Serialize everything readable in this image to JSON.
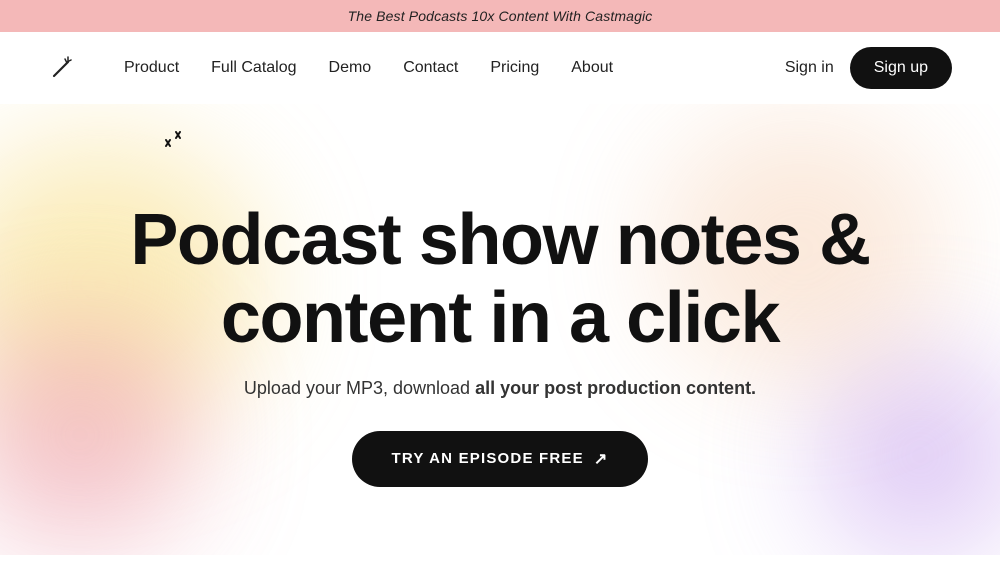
{
  "banner": {
    "text": "The Best Podcasts 10x Content With Castmagic"
  },
  "navbar": {
    "logo_icon": "wand-icon",
    "nav_links": [
      {
        "label": "Product",
        "href": "#"
      },
      {
        "label": "Full Catalog",
        "href": "#"
      },
      {
        "label": "Demo",
        "href": "#"
      },
      {
        "label": "Contact",
        "href": "#"
      },
      {
        "label": "Pricing",
        "href": "#"
      },
      {
        "label": "About",
        "href": "#"
      }
    ],
    "sign_in_label": "Sign in",
    "sign_up_label": "Sign up"
  },
  "hero": {
    "title_line1": "Podcast show notes &",
    "title_line2": "content in a click",
    "subtitle_normal": "Upload your MP3, download ",
    "subtitle_bold": "all your post production content.",
    "cta_label": "TRY AN EPISODE FREE",
    "cta_arrow": "↗"
  },
  "colors": {
    "banner_bg": "#f4b8b8",
    "cta_bg": "#111111",
    "signup_bg": "#111111"
  }
}
